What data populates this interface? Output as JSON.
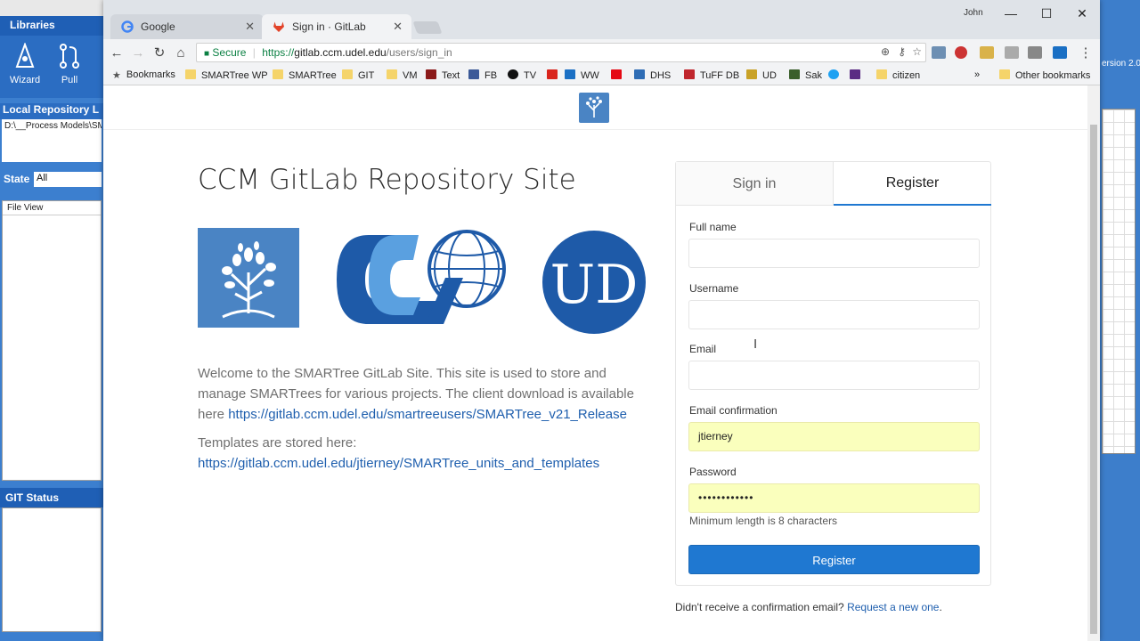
{
  "background_app": {
    "libraries_title": "Libraries",
    "ribbon": [
      {
        "label": "Wizard"
      },
      {
        "label": "Pull"
      }
    ],
    "local_repo_title": "Local Repository L",
    "local_repo_path": "D:\\__Process Models\\SM",
    "state_label": "State",
    "state_value": "All",
    "file_view_header": "File View",
    "git_status_title": "GIT Status",
    "right_version_text": "ersion 2.0"
  },
  "browser": {
    "user_name": "John",
    "tabs": [
      {
        "title": "Google",
        "icon": "google-icon"
      },
      {
        "title": "Sign in · GitLab",
        "icon": "gitlab-icon",
        "active": true
      }
    ],
    "window_controls": {
      "minimize": "—",
      "maximize": "☐",
      "close": "✕"
    },
    "address": {
      "secure_label": "Secure",
      "url_scheme": "https://",
      "url_host": "gitlab.ccm.udel.edu",
      "url_path": "/users/sign_in"
    },
    "bookmarks": [
      {
        "label": "Bookmarks",
        "icon": "star-icon"
      },
      {
        "label": "SMARTree WP",
        "icon": "folder-icon"
      },
      {
        "label": "SMARTree",
        "icon": "folder-icon"
      },
      {
        "label": "GIT",
        "icon": "folder-icon"
      },
      {
        "label": "VM",
        "icon": "folder-icon"
      },
      {
        "label": "Text",
        "icon": "text-icon"
      },
      {
        "label": "FB",
        "icon": "facebook-icon"
      },
      {
        "label": "TV",
        "icon": "tv-icon"
      },
      {
        "label": "",
        "icon": "z-icon"
      },
      {
        "label": "WW",
        "icon": "ww-icon"
      },
      {
        "label": "",
        "icon": "netflix-icon"
      },
      {
        "label": "DHS",
        "icon": "dhs-icon"
      },
      {
        "label": "TuFF DB",
        "icon": "tuff-icon"
      },
      {
        "label": "UD",
        "icon": "ud-icon"
      },
      {
        "label": "Sak",
        "icon": "sak-icon"
      },
      {
        "label": "",
        "icon": "twitter-icon"
      },
      {
        "label": "",
        "icon": "puzzle-icon"
      },
      {
        "label": "citizen",
        "icon": "folder-icon"
      },
      {
        "label": "»",
        "icon": "overflow-icon"
      },
      {
        "label": "Other bookmarks",
        "icon": "folder-icon"
      }
    ]
  },
  "page": {
    "title": "CCM GitLab Repository Site",
    "welcome_text": "Welcome to the SMARTree GitLab Site. This site is used to store and manage SMARTrees for various projects. The client download is available here",
    "download_link": "https://gitlab.ccm.udel.edu/smartreeusers/SMARTree_v21_Release",
    "templates_text": "Templates are stored here:",
    "templates_link": "https://gitlab.ccm.udel.edu/jtierney/SMARTree_units_and_templates",
    "logos": {
      "ud_letters": "UD"
    },
    "auth": {
      "tab_signin": "Sign in",
      "tab_register": "Register",
      "fields": [
        {
          "label": "Full name",
          "value": ""
        },
        {
          "label": "Username",
          "value": ""
        },
        {
          "label": "Email",
          "value": ""
        },
        {
          "label": "Email confirmation",
          "value": "jtierney"
        },
        {
          "label": "Password",
          "value": "••••••••••••"
        }
      ],
      "password_hint": "Minimum length is 8 characters",
      "register_button": "Register",
      "confirm_question": "Didn't receive a confirmation email?",
      "confirm_link": "Request a new one",
      "confirm_period": "."
    }
  },
  "colors": {
    "accent": "#1f78d1",
    "autofill": "#faffbd",
    "link": "#1f5fae",
    "brand_blue": "#4a84c4"
  }
}
